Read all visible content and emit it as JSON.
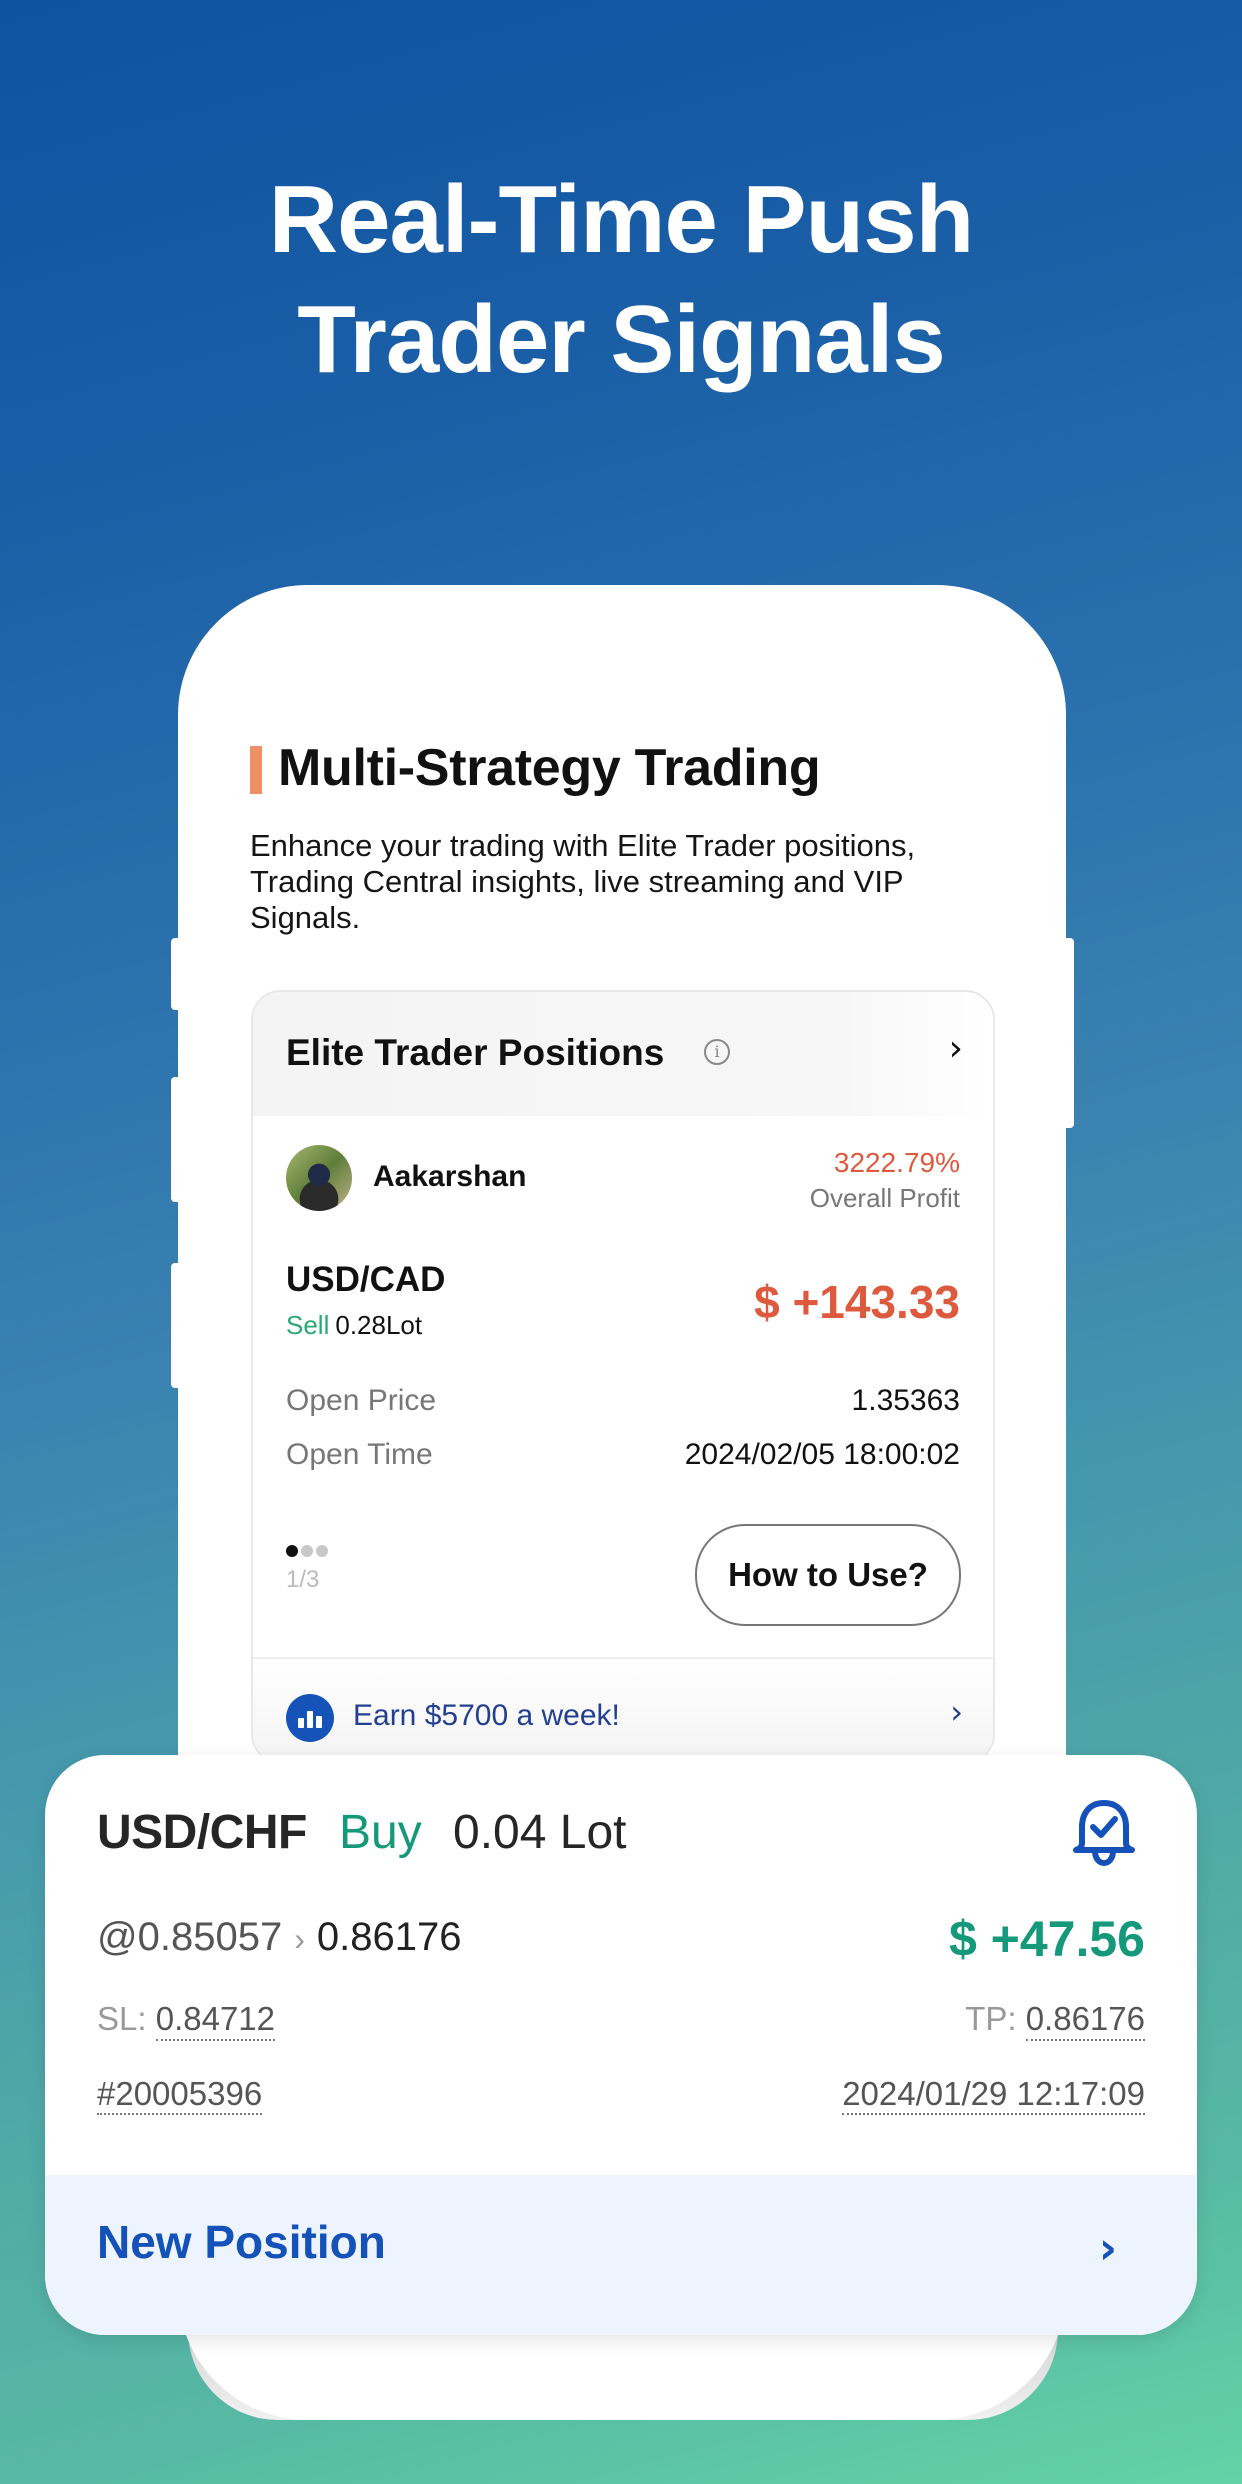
{
  "headline": {
    "line1": "Real-Time Push",
    "line2": "Trader Signals"
  },
  "section": {
    "title": "Multi-Strategy Trading",
    "description": "Enhance your trading with Elite Trader positions, Trading Central insights, live streaming and VIP Signals."
  },
  "elite_card": {
    "title": "Elite Trader Positions",
    "info_icon": "info-icon",
    "chevron": "›",
    "trader": {
      "name": "Aakarshan",
      "profit_pct": "3222.79%",
      "profit_label": "Overall Profit"
    },
    "position": {
      "pair": "USD/CAD",
      "side": "Sell",
      "lot": "0.28Lot",
      "pnl": "$ +143.33",
      "open_price_label": "Open Price",
      "open_price": "1.35363",
      "open_time_label": "Open Time",
      "open_time": "2024/02/05 18:00:02"
    },
    "pager": {
      "current": 1,
      "total": 3,
      "text": "1/3"
    },
    "how_button": "How to Use?",
    "earn_text": "Earn $5700 a week!",
    "earn_chevron": "›"
  },
  "signal": {
    "pair": "USD/CHF",
    "side": "Buy",
    "lot": "0.04 Lot",
    "open_price": "@0.85057",
    "arrow": "›",
    "current_price": "0.86176",
    "pnl": "$ +47.56",
    "sl_label": "SL:",
    "sl_value": "0.84712",
    "tp_label": "TP:",
    "tp_value": "0.86176",
    "order_id": "#20005396",
    "time": "2024/01/29 12:17:09",
    "new_position_label": "New Position",
    "chevron": "›"
  },
  "colors": {
    "accent_orange": "#ef9064",
    "loss_red": "#de5a3e",
    "profit_green": "#15997a",
    "brand_blue": "#1451b8"
  }
}
